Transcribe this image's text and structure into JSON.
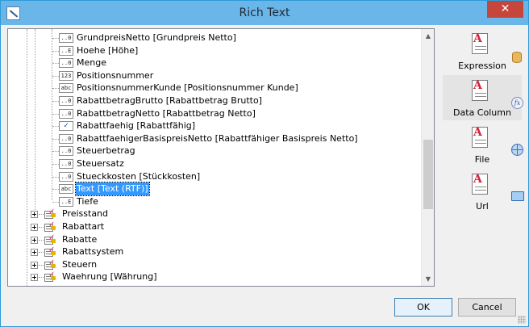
{
  "window": {
    "title": "Rich Text",
    "close_glyph": "✕"
  },
  "tree": {
    "fields": [
      {
        "icon": "..0",
        "label": "GrundpreisNetto [Grundpreis Netto]"
      },
      {
        "icon": "..E",
        "label": "Hoehe [Höhe]"
      },
      {
        "icon": "..0",
        "label": "Menge"
      },
      {
        "icon": "123",
        "label": "Positionsnummer"
      },
      {
        "icon": "abc",
        "label": "PositionsnummerKunde [Positionsnummer Kunde]"
      },
      {
        "icon": "..0",
        "label": "RabattbetragBrutto [Rabattbetrag Brutto]"
      },
      {
        "icon": "..0",
        "label": "RabattbetragNetto [Rabattbetrag Netto]"
      },
      {
        "icon": "✓",
        "label": "Rabattfaehig [Rabattfähig]"
      },
      {
        "icon": "..0",
        "label": "RabattfaehigerBasispreisNetto [Rabattfähiger Basispreis Netto]"
      },
      {
        "icon": "..0",
        "label": "Steuerbetrag"
      },
      {
        "icon": "..0",
        "label": "Steuersatz"
      },
      {
        "icon": "..0",
        "label": "Stueckkosten [Stückkosten]"
      },
      {
        "icon": "abc",
        "label": "Text [Text (RTF)]",
        "selected": true
      },
      {
        "icon": "..E",
        "label": "Tiefe"
      }
    ],
    "tables": [
      {
        "label": "Preisstand"
      },
      {
        "label": "Rabattart"
      },
      {
        "label": "Rabatte"
      },
      {
        "label": "Rabattsystem"
      },
      {
        "label": "Steuern"
      },
      {
        "label": "Waehrung [Währung]"
      }
    ],
    "scroll_arrows": {
      "up": "▲",
      "down": "▼"
    }
  },
  "sidebar": {
    "buttons": [
      {
        "label": "Expression",
        "icon": "expression-icon"
      },
      {
        "label": "Data Column",
        "icon": "data-column-icon",
        "active": true
      },
      {
        "label": "File",
        "icon": "file-icon"
      },
      {
        "label": "Url",
        "icon": "url-icon"
      }
    ]
  },
  "footer": {
    "ok_label": "OK",
    "cancel_label": "Cancel"
  },
  "colors": {
    "titlebar": "#6ab6e9",
    "close": "#c7463c",
    "selection": "#3399ff"
  }
}
